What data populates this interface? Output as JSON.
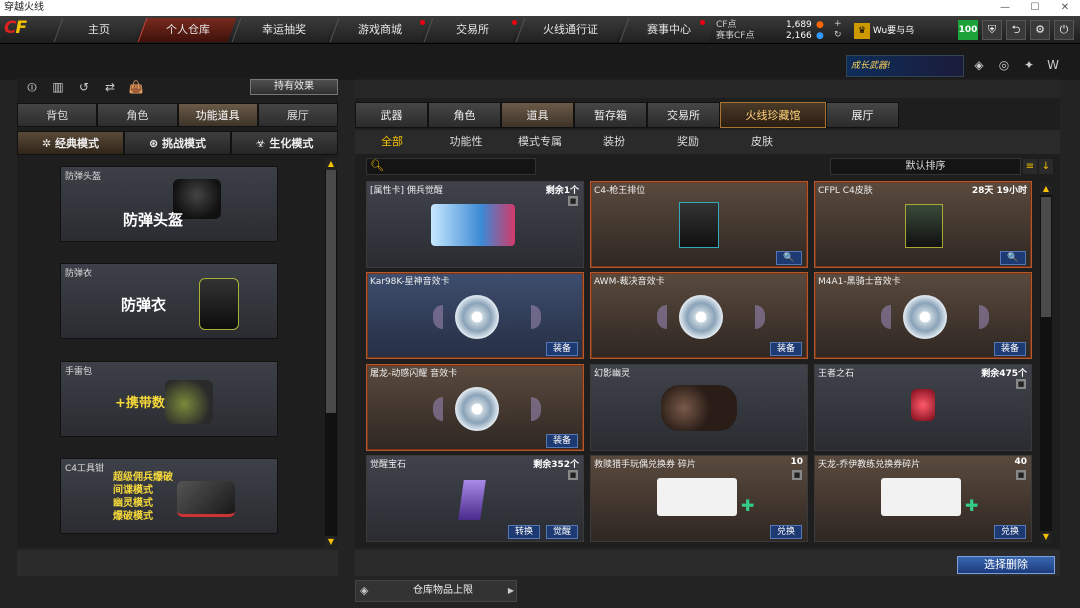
{
  "window": {
    "title": "穿越火线"
  },
  "topnav": {
    "logo": "CF",
    "tabs": [
      {
        "label": "主页"
      },
      {
        "label": "个人仓库"
      },
      {
        "label": "幸运抽奖"
      },
      {
        "label": "游戏商城"
      },
      {
        "label": "交易所"
      },
      {
        "label": "火线通行证"
      },
      {
        "label": "赛事中心"
      }
    ]
  },
  "currency": {
    "cf_label": "CF点",
    "cf_value": "1,689",
    "event_label": "赛事CF点",
    "event_value": "2,166"
  },
  "user": {
    "name": "Wu要与乌",
    "level": "100"
  },
  "promo": {
    "banner_text": "成长武器!"
  },
  "left": {
    "effect_button": "持有效果",
    "tabs": [
      "背包",
      "角色",
      "功能道具",
      "展厅"
    ],
    "modes": [
      "经典模式",
      "挑战模式",
      "生化模式"
    ],
    "slots": [
      {
        "label": "防弹头盔",
        "text": "防弹头盔"
      },
      {
        "label": "防弹衣",
        "text": "防弹衣"
      },
      {
        "label": "手雷包",
        "text": "+携带数"
      },
      {
        "label": "C4工具钳",
        "lines": [
          "超级佣兵爆破",
          "间谍模式",
          "幽灵模式",
          "爆破模式"
        ]
      }
    ]
  },
  "right": {
    "tabs": [
      "武器",
      "角色",
      "道具",
      "暂存箱",
      "交易所",
      "火线珍藏馆",
      "展厅"
    ],
    "subtabs": [
      "全部",
      "功能性",
      "模式专属",
      "装扮",
      "奖励",
      "皮肤"
    ],
    "sort": "默认排序",
    "items": [
      {
        "name": "[属性卡] 佣兵觉醒",
        "qty": "剩余1个"
      },
      {
        "name": "C4-枪王排位",
        "qty": "",
        "action": "🔍"
      },
      {
        "name": "CFPL C4皮肤",
        "qty": "28天 19小时",
        "action": "🔍"
      },
      {
        "name": "Kar98K-星神音效卡",
        "qty": "",
        "action": "装备"
      },
      {
        "name": "AWM-裁决音效卡",
        "qty": "",
        "action": "装备"
      },
      {
        "name": "M4A1-黑骑士音效卡",
        "qty": "",
        "action": "装备"
      },
      {
        "name": "屠龙-动感闪耀 音效卡",
        "qty": "",
        "action": "装备"
      },
      {
        "name": "幻影幽灵",
        "qty": ""
      },
      {
        "name": "王者之石",
        "qty": "剩余475个"
      },
      {
        "name": "觉醒宝石",
        "qty": "剩余352个",
        "action": "转换",
        "action2": "觉醒"
      },
      {
        "name": "救赎猎手玩偶兑换券 碎片",
        "qty": "10",
        "action": "兑换"
      },
      {
        "name": "天龙-乔伊教练兑换券碎片",
        "qty": "40",
        "action": "兑换"
      }
    ],
    "delete_button": "选择删除",
    "capacity_label": "仓库物品上限"
  }
}
